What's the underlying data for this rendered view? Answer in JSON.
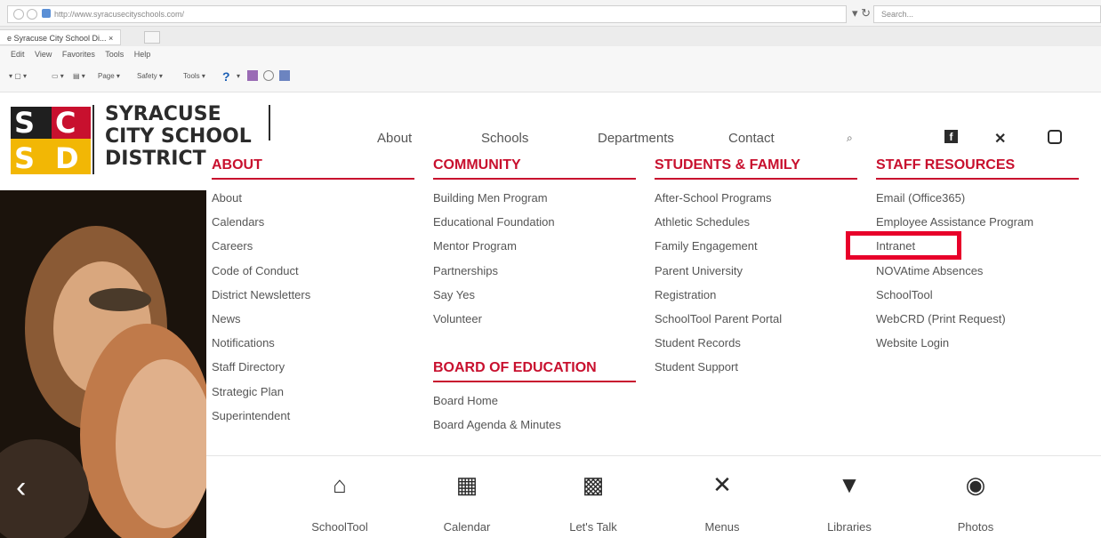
{
  "browser": {
    "url": "http://www.syracusecityschools.com/",
    "search_placeholder": "Search...",
    "tab_title": "e Syracuse City School Di... ×",
    "menu": [
      "Edit",
      "View",
      "Favorites",
      "Tools",
      "Help"
    ],
    "commands": [
      "Page ▾",
      "Safety ▾",
      "Tools ▾"
    ]
  },
  "site": {
    "logo_lines": [
      "SYRACUSE",
      "CITY SCHOOL",
      "DISTRICT"
    ],
    "nav": [
      "About",
      "Schools",
      "Departments",
      "Contact"
    ],
    "social": [
      "facebook-icon",
      "twitter-icon",
      "instagram-icon"
    ]
  },
  "mega_menu": {
    "about": {
      "heading": "ABOUT",
      "items": [
        "About",
        "Calendars",
        "Careers",
        "Code of Conduct",
        "District Newsletters",
        "News",
        "Notifications",
        "Staff Directory",
        "Strategic Plan",
        "Superintendent"
      ]
    },
    "community": {
      "heading": "COMMUNITY",
      "items": [
        "Building Men Program",
        "Educational Foundation",
        "Mentor Program",
        "Partnerships",
        "Say Yes",
        "Volunteer"
      ]
    },
    "board": {
      "heading": "BOARD OF EDUCATION",
      "items": [
        "Board Home",
        "Board Agenda & Minutes"
      ]
    },
    "students": {
      "heading": "STUDENTS & FAMILY",
      "items": [
        "After-School Programs",
        "Athletic Schedules",
        "Family Engagement",
        "Parent University",
        "Registration",
        "SchoolTool Parent Portal",
        "Student Records",
        "Student Support"
      ]
    },
    "staff": {
      "heading": "STAFF RESOURCES",
      "items": [
        "Email (Office365)",
        "Employee Assistance Program",
        "Intranet",
        "NOVAtime Absences",
        "SchoolTool",
        "WebCRD (Print Request)",
        "Website Login"
      ]
    }
  },
  "quick_links": [
    {
      "label": "SchoolTool",
      "icon": "home-icon"
    },
    {
      "label": "Calendar",
      "icon": "calendar-icon"
    },
    {
      "label": "Let's Talk",
      "icon": "lets-talk-icon"
    },
    {
      "label": "Menus",
      "icon": "utensils-icon"
    },
    {
      "label": "Libraries",
      "icon": "library-icon"
    },
    {
      "label": "Photos",
      "icon": "camera-icon"
    }
  ],
  "colors": {
    "brand_red": "#c8102e",
    "highlight_red": "#e8002a",
    "brand_yellow": "#f2b705"
  }
}
